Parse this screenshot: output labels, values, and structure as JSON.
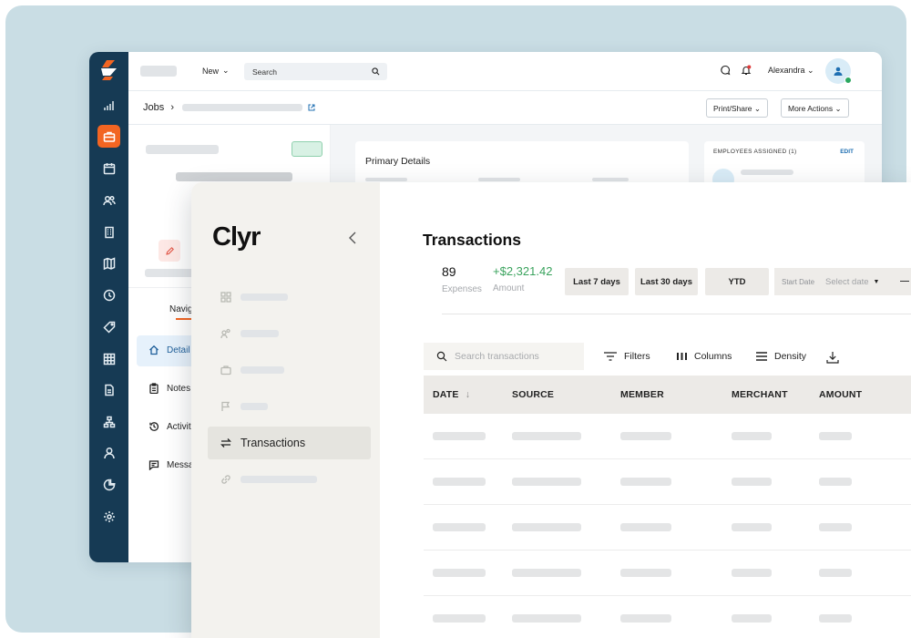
{
  "colors": {
    "accent": "#f26522",
    "rail": "#163a54",
    "positive": "#3aa35d",
    "link": "#1f6fb2"
  },
  "back_app": {
    "topbar": {
      "new_label": "New",
      "search_placeholder": "Search",
      "user_name": "Alexandra"
    },
    "breadcrumb": {
      "root": "Jobs",
      "separator": "›"
    },
    "actions": {
      "print_share": "Print/Share",
      "more_actions": "More Actions"
    },
    "rail_icons": [
      "chart-icon",
      "briefcase-icon",
      "calendar-icon",
      "users-icon",
      "building-icon",
      "map-icon",
      "clock-icon",
      "tag-icon",
      "grid-icon",
      "document-icon",
      "org-icon",
      "person-icon",
      "pie-icon",
      "gear-icon"
    ],
    "left_nav": {
      "tab_label": "Navig",
      "items": [
        {
          "label": "Detail",
          "icon": "home-icon"
        },
        {
          "label": "Notes",
          "icon": "clipboard-icon"
        },
        {
          "label": "Activit",
          "icon": "history-icon"
        },
        {
          "label": "Messa",
          "icon": "chat-icon"
        }
      ]
    },
    "primary_details": {
      "title": "Primary Details"
    },
    "employees": {
      "title": "EMPLOYEES ASSIGNED (1)",
      "edit": "EDIT"
    }
  },
  "front_app": {
    "brand": "Clyr",
    "sidebar": {
      "active_item": "Transactions"
    },
    "title": "Transactions",
    "stats": {
      "expenses_count": "89",
      "expenses_label": "Expenses",
      "amount_value": "+$2,321.42",
      "amount_label": "Amount"
    },
    "ranges": [
      "Last 7 days",
      "Last 30 days",
      "YTD"
    ],
    "date_filter": {
      "start_label": "Start Date",
      "select_placeholder": "Select date"
    },
    "toolbar": {
      "search_placeholder": "Search transactions",
      "filters": "Filters",
      "columns": "Columns",
      "density": "Density"
    },
    "table": {
      "columns": [
        "DATE",
        "SOURCE",
        "MEMBER",
        "MERCHANT",
        "AMOUNT"
      ]
    }
  }
}
